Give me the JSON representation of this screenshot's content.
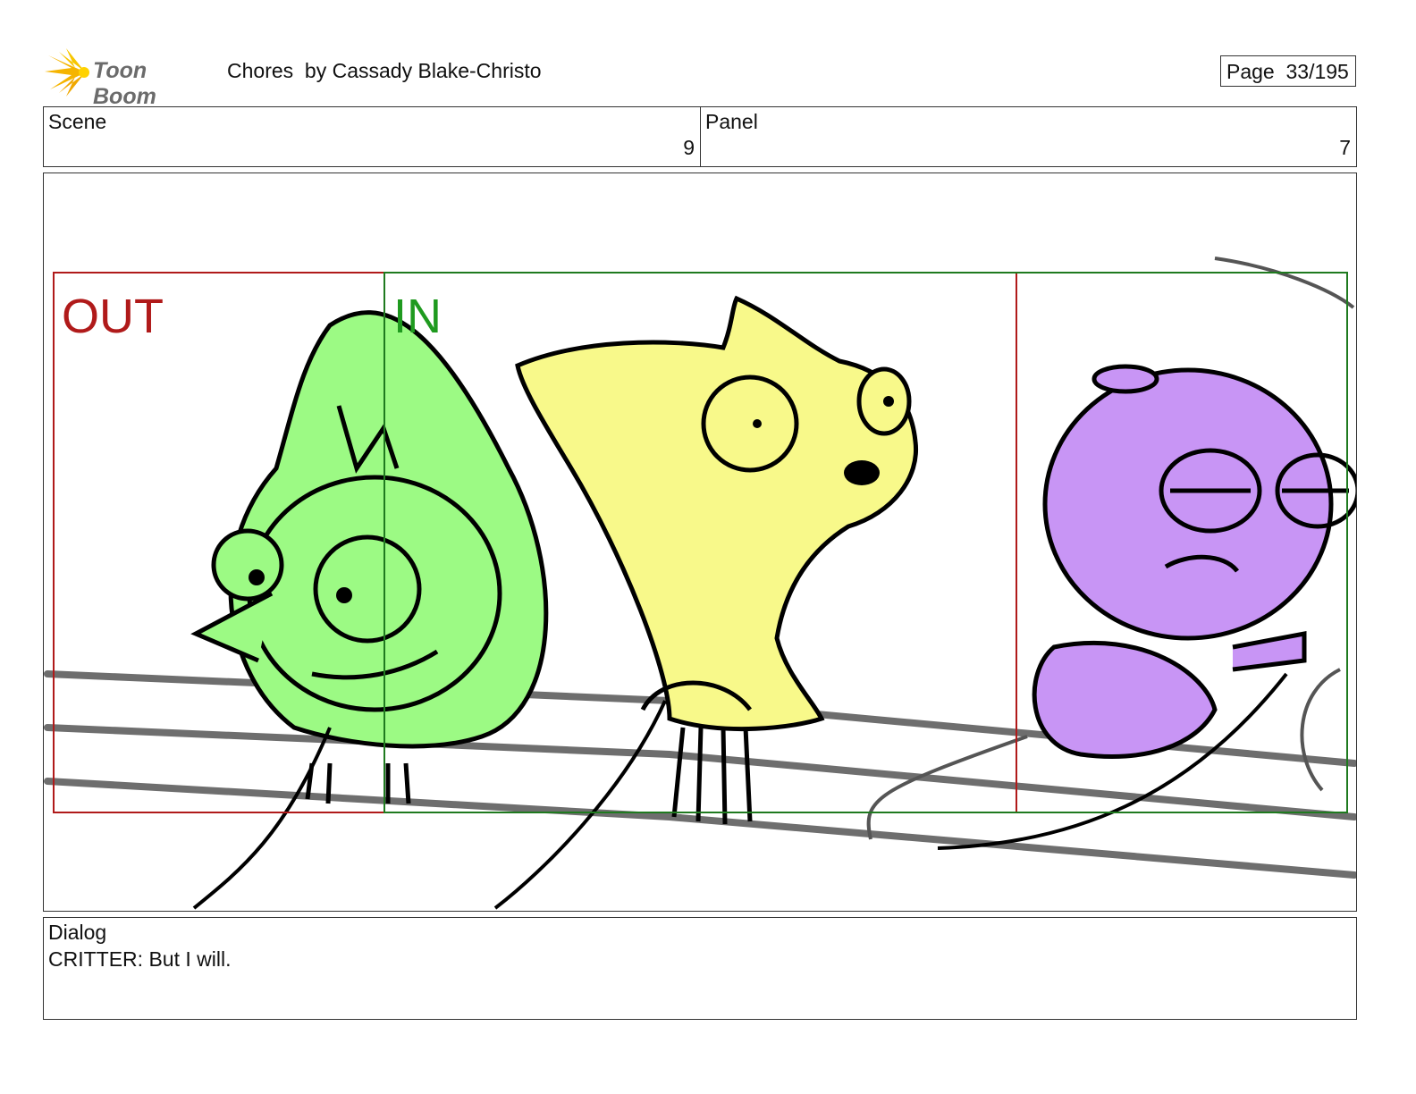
{
  "header": {
    "logo_text": "Toon Boom",
    "title": "Chores  by Cassady Blake-Christo",
    "page": "Page  33/195"
  },
  "meta": {
    "scene_label": "Scene",
    "scene_value": "9",
    "panel_label": "Panel",
    "panel_value": "7"
  },
  "frame": {
    "out_label": "OUT",
    "in_label": "IN",
    "colors": {
      "out_frame": "#b01a1a",
      "in_frame": "#1f7a1f",
      "green_character": "#9cfa84",
      "yellow_character": "#f8f98a",
      "purple_character": "#c895f5",
      "rail": "#6e6e6e"
    }
  },
  "dialog": {
    "label": "Dialog",
    "text": "CRITTER: But I will."
  }
}
